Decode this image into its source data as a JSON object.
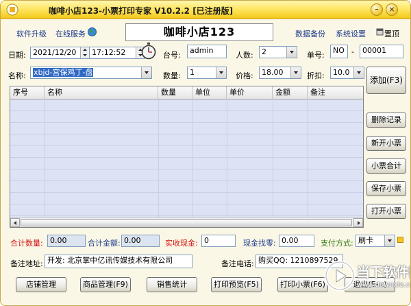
{
  "window": {
    "title": "咖啡小店123-小票打印专家 V10.2.2 [已注册版]"
  },
  "topbar": {
    "upgrade": "软件升级",
    "online_service": "在线服务",
    "shop_name": "咖啡小店123",
    "backup": "数据备份",
    "settings": "系统设置",
    "pin_top": "置顶"
  },
  "form": {
    "date_label": "日期:",
    "date_value": "2021/12/20",
    "time_value": "17:12:52",
    "table_label": "台号:",
    "table_value": "admin",
    "people_label": "人数:",
    "people_value": "2",
    "order_label": "单号:",
    "order_prefix": "NO",
    "order_dash": "-",
    "order_value": "00001",
    "name_label": "名称:",
    "name_value": "xbjd-宫保鸡丁-盘",
    "qty_label": "数量:",
    "qty_value": "1",
    "price_label": "价格:",
    "price_value": "18.00",
    "discount_label": "折扣:",
    "discount_value": "10.0"
  },
  "grid": {
    "columns": [
      "序号",
      "名称",
      "数量",
      "单位",
      "单价",
      "金额",
      "备注"
    ],
    "rows": []
  },
  "side_buttons": {
    "add": "添加(F3)",
    "delete": "删除记录",
    "new_ticket": "新开小票",
    "ticket_total": "小票合计",
    "save_ticket": "保存小票",
    "open_ticket": "打开小票"
  },
  "totals": {
    "total_qty_label": "合计数量:",
    "total_qty_value": "0.00",
    "total_amount_label": "合计金额:",
    "total_amount_value": "0.00",
    "cash_label": "实收现金:",
    "cash_value": "0",
    "change_label": "现金找零:",
    "change_value": "0.00",
    "pay_label": "支付方式:",
    "pay_value": "刷卡"
  },
  "footer_info": {
    "addr_label": "备注地址:",
    "addr_value": "开发: 北京掌中亿讯传媒技术有限公司",
    "phone_label": "备注电话:",
    "phone_value": "购买QQ: 1210897529"
  },
  "bottom_buttons": {
    "store": "店铺管理",
    "goods": "商品管理(F9)",
    "sales": "销售统计",
    "preview": "打印预览(F5)",
    "print": "打印小票(F6)",
    "exit": "退出(Esc)"
  },
  "watermark": {
    "text": "当下软件园",
    "sub": "www.downxia.com"
  }
}
